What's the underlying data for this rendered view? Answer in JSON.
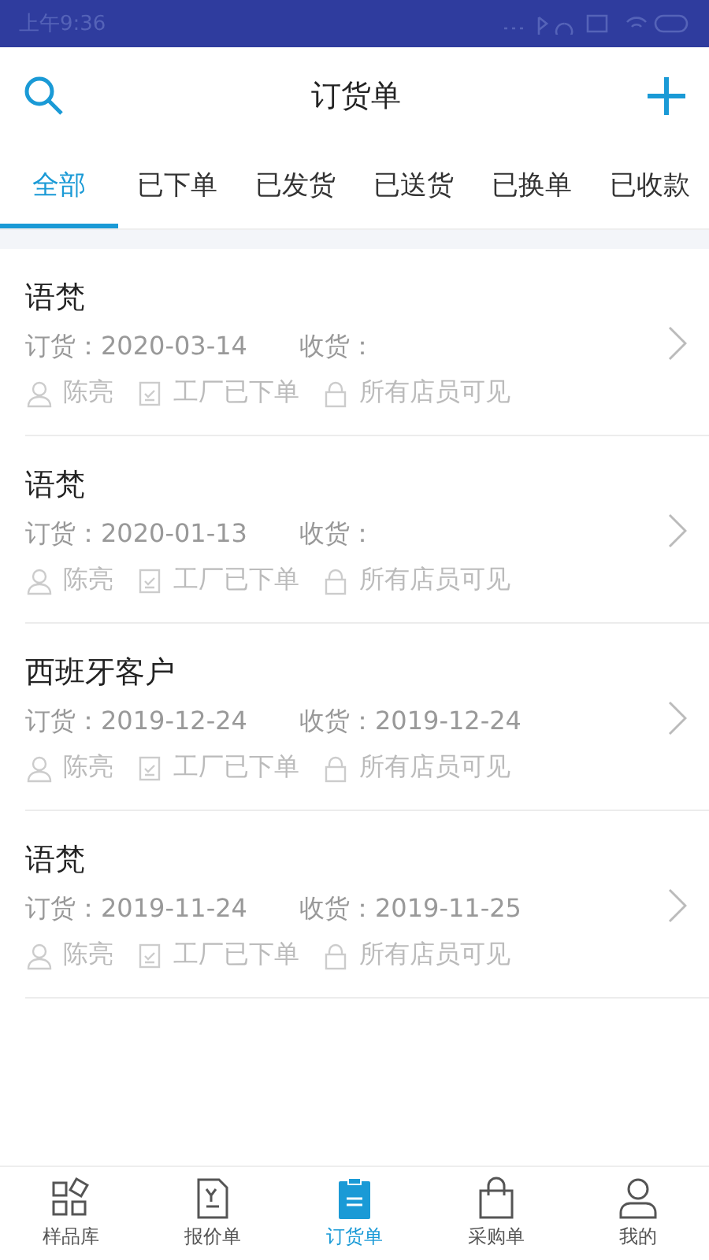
{
  "status_bar": {
    "time": "上午9:36"
  },
  "header": {
    "title": "订货单"
  },
  "tabs": [
    {
      "label": "全部",
      "selected": true
    },
    {
      "label": "已下单",
      "selected": false
    },
    {
      "label": "已发货",
      "selected": false
    },
    {
      "label": "已送货",
      "selected": false
    },
    {
      "label": "已换单",
      "selected": false
    },
    {
      "label": "已收款",
      "selected": false
    }
  ],
  "orders": [
    {
      "customer": "语梵",
      "order_date": "订货：2020-03-14",
      "receive_date": "收货：",
      "staff": "陈亮",
      "status": "工厂已下单",
      "visibility": "所有店员可见"
    },
    {
      "customer": "语梵",
      "order_date": "订货：2020-01-13",
      "receive_date": "收货：",
      "staff": "陈亮",
      "status": "工厂已下单",
      "visibility": "所有店员可见"
    },
    {
      "customer": "西班牙客户",
      "order_date": "订货：2019-12-24",
      "receive_date": "收货：2019-12-24",
      "staff": "陈亮",
      "status": "工厂已下单",
      "visibility": "所有店员可见"
    },
    {
      "customer": "语梵",
      "order_date": "订货：2019-11-24",
      "receive_date": "收货：2019-11-25",
      "staff": "陈亮",
      "status": "工厂已下单",
      "visibility": "所有店员可见"
    }
  ],
  "bottom_nav": [
    {
      "kind": "samples",
      "label": "样品库",
      "selected": false
    },
    {
      "kind": "quote",
      "label": "报价单",
      "selected": false
    },
    {
      "kind": "orders",
      "label": "订货单",
      "selected": true
    },
    {
      "kind": "purchase",
      "label": "采购单",
      "selected": false
    },
    {
      "kind": "profile",
      "label": "我的",
      "selected": false
    }
  ]
}
